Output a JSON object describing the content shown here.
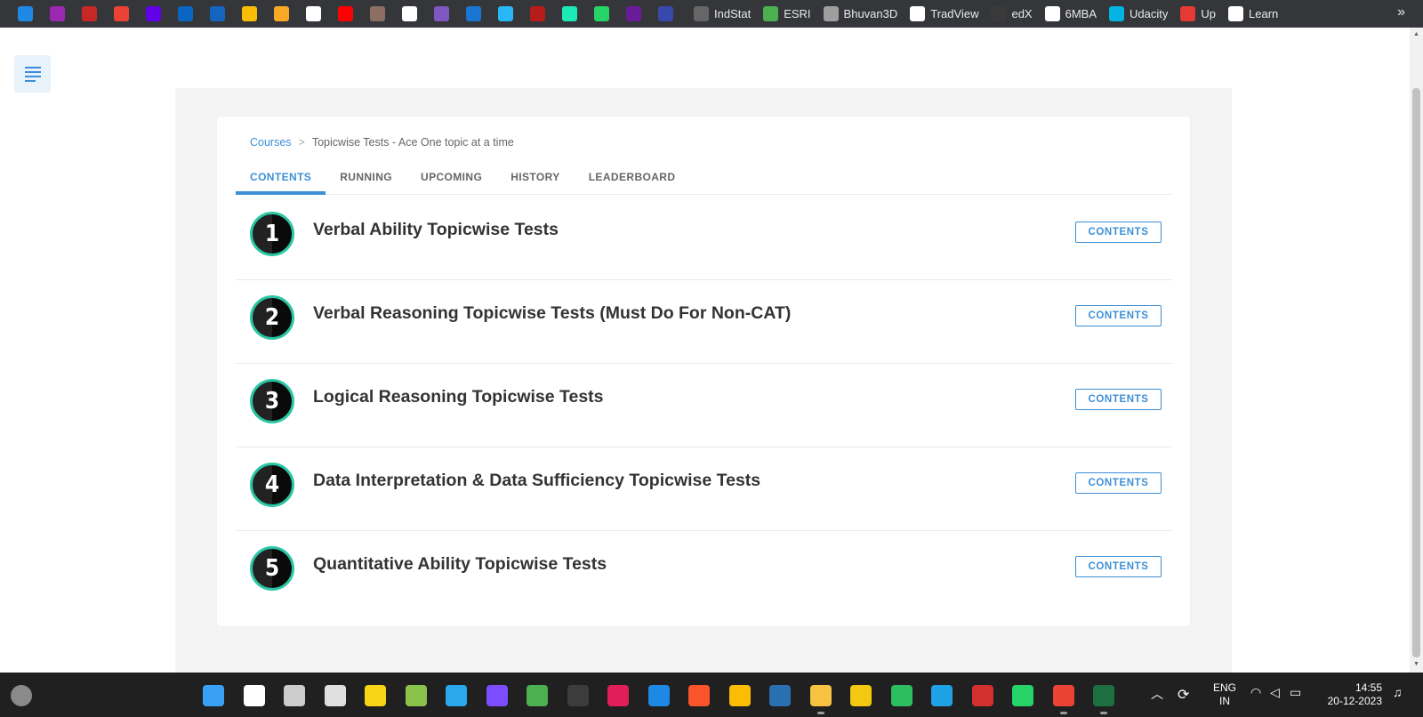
{
  "bookmarks": {
    "icons": [
      {
        "name": "pen-icon",
        "color": "#1e88e5"
      },
      {
        "name": "b-logo-icon",
        "color": "#9c27b0"
      },
      {
        "name": "news-icon",
        "color": "#c62828"
      },
      {
        "name": "gmail-icon",
        "color": "#ea4335"
      },
      {
        "name": "mail-icon",
        "color": "#6200ea"
      },
      {
        "name": "linkedin-icon",
        "color": "#0a66c2"
      },
      {
        "name": "play-icon",
        "color": "#1565c0"
      },
      {
        "name": "drive-icon",
        "color": "#fbbc04"
      },
      {
        "name": "image-icon",
        "color": "#f9a825"
      },
      {
        "name": "google-icon",
        "color": "#ffffff"
      },
      {
        "name": "youtube-icon",
        "color": "#ff0000"
      },
      {
        "name": "emblem-icon",
        "color": "#8d6e63"
      },
      {
        "name": "openai-icon",
        "color": "#ffffff"
      },
      {
        "name": "u-logo-icon",
        "color": "#7e57c2"
      },
      {
        "name": "c-logo-icon",
        "color": "#1976d2"
      },
      {
        "name": "s-logo-icon",
        "color": "#29b6f6"
      },
      {
        "name": "speedometer-icon",
        "color": "#b71c1c"
      },
      {
        "name": "vimeo-icon",
        "color": "#1de9b6"
      },
      {
        "name": "whatsapp-icon",
        "color": "#25d366"
      },
      {
        "name": "upwork-icon",
        "color": "#6a1b9a"
      },
      {
        "name": "f-logo-icon",
        "color": "#3949ab"
      }
    ],
    "labeled": [
      {
        "name": "indstat",
        "label": "IndStat",
        "icon": "dots-icon",
        "color": "#666666"
      },
      {
        "name": "esri",
        "label": "ESRI",
        "icon": "globe-icon",
        "color": "#4caf50"
      },
      {
        "name": "bhuvan3d",
        "label": "Bhuvan3D",
        "icon": "avatar-icon",
        "color": "#9e9e9e"
      },
      {
        "name": "tradview",
        "label": "TradView",
        "icon": "tradingview-icon",
        "color": "#ffffff"
      },
      {
        "name": "edx",
        "label": "edX",
        "icon": "edx-icon",
        "color": "#3a3a3a"
      },
      {
        "name": "6mba",
        "label": "6MBA",
        "icon": "book-icon",
        "color": "#ffffff"
      },
      {
        "name": "udacity",
        "label": "Udacity",
        "icon": "udacity-icon",
        "color": "#02b3e4"
      },
      {
        "name": "up",
        "label": "Up",
        "icon": "shield-icon",
        "color": "#e53935"
      },
      {
        "name": "learn",
        "label": "Learn",
        "icon": "l-logo-icon",
        "color": "#ffffff"
      }
    ],
    "overflow": "»"
  },
  "breadcrumb": {
    "root": "Courses",
    "separator": ">",
    "current": "Topicwise Tests - Ace One topic at a time"
  },
  "tabs": [
    {
      "label": "CONTENTS",
      "active": true
    },
    {
      "label": "RUNNING",
      "active": false
    },
    {
      "label": "UPCOMING",
      "active": false
    },
    {
      "label": "HISTORY",
      "active": false
    },
    {
      "label": "LEADERBOARD",
      "active": false
    }
  ],
  "items": [
    {
      "number": "1",
      "title": "Verbal Ability Topicwise Tests",
      "button": "CONTENTS"
    },
    {
      "number": "2",
      "title": "Verbal Reasoning Topicwise Tests (Must Do For Non-CAT)",
      "button": "CONTENTS"
    },
    {
      "number": "3",
      "title": "Logical Reasoning Topicwise Tests",
      "button": "CONTENTS"
    },
    {
      "number": "4",
      "title": "Data Interpretation & Data Sufficiency Topicwise Tests",
      "button": "CONTENTS"
    },
    {
      "number": "5",
      "title": "Quantitative Ability Topicwise Tests",
      "button": "CONTENTS"
    }
  ],
  "taskbar": {
    "apps": [
      {
        "name": "windows-start-icon",
        "color": "#3aa0f3"
      },
      {
        "name": "search-icon",
        "color": "#ffffff"
      },
      {
        "name": "task-view-icon",
        "color": "#cccccc"
      },
      {
        "name": "snipping-tool-icon",
        "color": "#e0e0e0"
      },
      {
        "name": "sticky-notes-icon",
        "color": "#f7d417"
      },
      {
        "name": "notepad-icon",
        "color": "#8bc34a"
      },
      {
        "name": "telegram-icon",
        "color": "#29a9eb"
      },
      {
        "name": "prism-icon",
        "color": "#7c4dff"
      },
      {
        "name": "loader-icon",
        "color": "#4caf50"
      },
      {
        "name": "terminal-icon",
        "color": "#3c3c3c"
      },
      {
        "name": "slack-icon",
        "color": "#e01e5a"
      },
      {
        "name": "mail-app-icon",
        "color": "#1e88e5"
      },
      {
        "name": "brave-icon",
        "color": "#fb542b"
      },
      {
        "name": "chrome-icon",
        "color": "#fbbc04"
      },
      {
        "name": "mysql-workbench-icon",
        "color": "#2a6fb0"
      },
      {
        "name": "file-explorer-icon",
        "color": "#f5c242"
      },
      {
        "name": "power-bi-icon",
        "color": "#f2c811"
      },
      {
        "name": "evernote-icon",
        "color": "#2dbe60"
      },
      {
        "name": "edge-icon",
        "color": "#1fa1e6"
      },
      {
        "name": "acrobat-icon",
        "color": "#d32f2f"
      },
      {
        "name": "whatsapp-app-icon",
        "color": "#25d366"
      },
      {
        "name": "chrome-active-icon",
        "color": "#ea4335"
      },
      {
        "name": "excel-icon",
        "color": "#1d6f42"
      }
    ],
    "language_line1": "ENG",
    "language_line2": "IN",
    "time": "14:55",
    "date": "20-12-2023"
  }
}
